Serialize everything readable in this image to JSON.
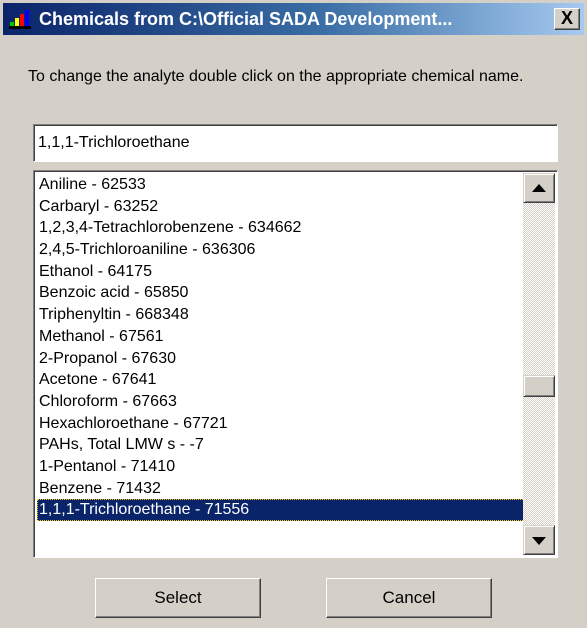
{
  "window": {
    "title": "Chemicals from C:\\Official SADA Development...",
    "close_label": "X",
    "icon": "app-chart-icon"
  },
  "instruction": "To change the analyte double click on the appropriate chemical name.",
  "analyte_field": {
    "value": "1,1,1-Trichloroethane"
  },
  "chemical_list": {
    "items": [
      "Aniline  -  62533",
      "Carbaryl  -  63252",
      "1,2,3,4-Tetrachlorobenzene  -  634662",
      "2,4,5-Trichloroaniline  -  636306",
      "Ethanol  -  64175",
      "Benzoic acid  -  65850",
      "Triphenyltin  -  668348",
      "Methanol  -  67561",
      "2-Propanol  -  67630",
      "Acetone  -  67641",
      "Chloroform  -  67663",
      "Hexachloroethane  -  67721",
      "PAHs, Total LMW s  -  -7",
      "1-Pentanol  -  71410",
      "Benzene  -  71432",
      "1,1,1-Trichloroethane  -  71556"
    ],
    "selected_index": 15
  },
  "buttons": {
    "select_label": "Select",
    "cancel_label": "Cancel"
  },
  "colors": {
    "titlebar_start": "#0a246a",
    "titlebar_end": "#a6caf0",
    "selection": "#0a246a",
    "face": "#d4d0c8"
  }
}
